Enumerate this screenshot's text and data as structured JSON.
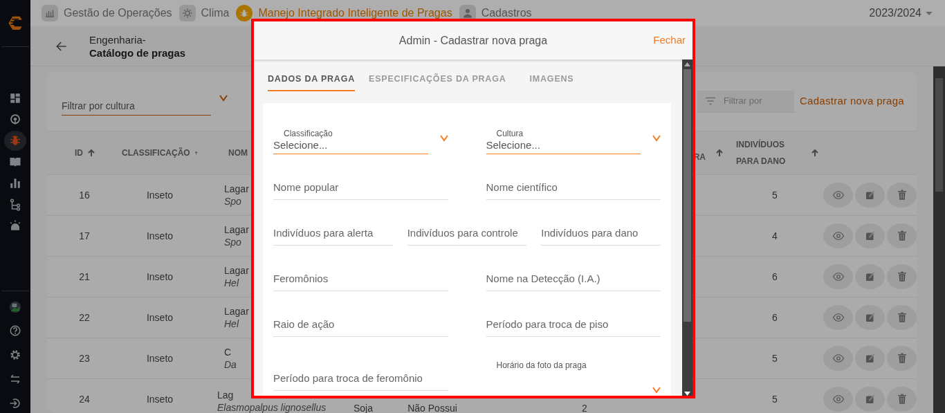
{
  "top_nav": {
    "items": [
      {
        "label": "Gestão de Operações",
        "selected": false
      },
      {
        "label": "Clima",
        "selected": false
      },
      {
        "label": "Manejo Integrado Inteligente de Pragas",
        "selected": true
      },
      {
        "label": "Cadastros",
        "selected": false
      }
    ],
    "season": "2023/2024"
  },
  "sidebar": {
    "items": [
      {
        "selected": false
      },
      {
        "selected": false
      },
      {
        "selected": true
      },
      {
        "selected": false
      },
      {
        "selected": false
      },
      {
        "selected": false
      },
      {
        "selected": false
      }
    ]
  },
  "header": {
    "parent": "Engenharia-",
    "title": "Catálogo de pragas"
  },
  "culture_filter": {
    "placeholder": "Filtrar por cultura"
  },
  "search": {
    "placeholder": "Filtrar por"
  },
  "add_button": "Cadastrar nova praga",
  "table": {
    "columns": [
      {
        "label": "ID",
        "sortable": true
      },
      {
        "label": "CLASSIFICAÇÃO",
        "sortable": true
      },
      {
        "label": "NOM",
        "sortable": false
      },
      {
        "label": "RA",
        "sortable": true
      },
      {
        "label": "INDIVÍDUOS PARA DANO",
        "sortable": true
      }
    ],
    "rows": [
      {
        "id": "16",
        "classification": "Inseto",
        "name": "Lagar",
        "scientific": "Spo",
        "damage": "5"
      },
      {
        "id": "17",
        "classification": "Inseto",
        "name": "Lagar",
        "scientific": "Spo",
        "damage": "4"
      },
      {
        "id": "21",
        "classification": "Inseto",
        "name": "Lagar",
        "scientific": "Hel",
        "damage": "6"
      },
      {
        "id": "22",
        "classification": "Inseto",
        "name": "Lagar",
        "scientific": "Hel",
        "damage": "6"
      },
      {
        "id": "23",
        "classification": "Inseto",
        "name": "C",
        "scientific": "Da",
        "damage": "5"
      },
      {
        "id": "24",
        "classification": "Inseto",
        "name": "Lag",
        "scientific": "Elasmopalpus lignosellus",
        "culture": "Soja",
        "pheromone": "Não Possui",
        "alert": "2",
        "damage": "5"
      }
    ]
  },
  "modal": {
    "title": "Admin - Cadastrar nova praga",
    "close": "Fechar",
    "tabs": [
      {
        "label": "DADOS DA PRAGA",
        "selected": true
      },
      {
        "label": "ESPECIFICAÇÕES DA PRAGA",
        "selected": false
      },
      {
        "label": "IMAGENS",
        "selected": false
      }
    ],
    "form_rows": [
      [
        {
          "kind": "select",
          "label": "Classificação",
          "value": "Selecione..."
        },
        {
          "kind": "select",
          "label": "Cultura",
          "value": "Selecione..."
        }
      ],
      [
        {
          "kind": "input",
          "placeholder": "Nome popular"
        },
        {
          "kind": "input",
          "placeholder": "Nome científico"
        }
      ],
      [
        {
          "kind": "input",
          "placeholder": "Indivíduos para alerta"
        },
        {
          "kind": "input",
          "placeholder": "Indivíduos para controle"
        },
        {
          "kind": "input",
          "placeholder": "Indivíduos para dano"
        }
      ],
      [
        {
          "kind": "input",
          "placeholder": "Feromônios"
        },
        {
          "kind": "input",
          "placeholder": "Nome na Detecção (I.A.)"
        }
      ],
      [
        {
          "kind": "input",
          "placeholder": "Raio de ação"
        },
        {
          "kind": "input",
          "placeholder": "Período para troca de piso"
        }
      ],
      [
        {
          "kind": "input",
          "placeholder": "Período para troca de feromônio"
        },
        {
          "kind": "select",
          "label": "Horário da foto da praga"
        }
      ]
    ]
  }
}
